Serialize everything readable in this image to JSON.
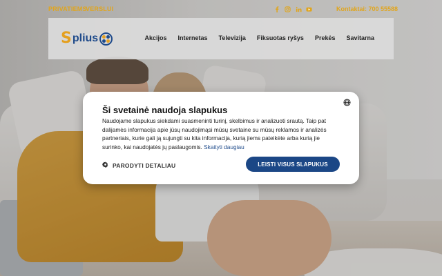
{
  "topbar": {
    "segments": [
      "PRIVATIEMS",
      "VERSLUI"
    ],
    "social_icons": [
      "facebook-icon",
      "instagram-icon",
      "linkedin-icon",
      "youtube-icon"
    ],
    "contacts": "Kontaktai: 700 55588"
  },
  "header": {
    "logo_letter": "S",
    "logo_text": "plius",
    "nav": [
      "Akcijos",
      "Internetas",
      "Televizija",
      "Fiksuotas ryšys",
      "Prekės",
      "Savitarna"
    ]
  },
  "cookie_banner": {
    "title": "Ši svetainė naudoja slapukus",
    "body": "Naudojame slapukus siekdami suasmeninti turinį, skelbimus ir analizuoti srautą. Taip pat dalijamės informacija apie jūsų naudojimąsi mūsų svetaine su mūsų reklamos ir analizės partneriais, kurie gali ją sujungti su kita informacija, kurią jiems pateikėte arba kurią jie surinko, kai naudojatės jų paslaugomis.",
    "more_link": "Skaityti daugiau",
    "details_button": "PARODYTI DETALIAU",
    "accept_button": "LEISTI VISUS SLAPUKUS",
    "language_icon": "globe-icon"
  },
  "colors": {
    "accent": "#e0a51d",
    "brand_blue": "#1b4786"
  }
}
